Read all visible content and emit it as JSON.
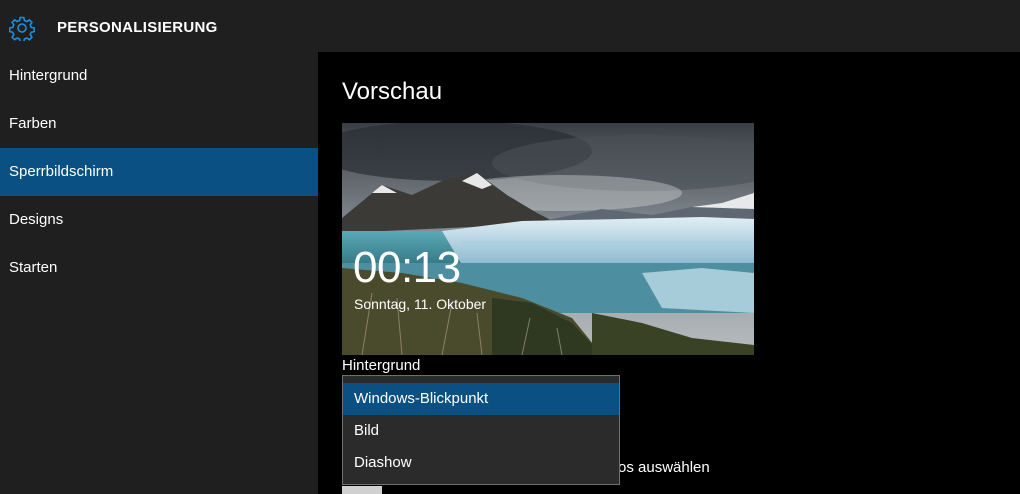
{
  "app": {
    "title": "PERSONALISIERUNG",
    "icon": "gear-icon",
    "accent_color": "#0a5083"
  },
  "sidebar": {
    "items": [
      {
        "label": "Hintergrund",
        "selected": false
      },
      {
        "label": "Farben",
        "selected": false
      },
      {
        "label": "Sperrbildschirm",
        "selected": true
      },
      {
        "label": "Designs",
        "selected": false
      },
      {
        "label": "Starten",
        "selected": false
      }
    ]
  },
  "main": {
    "section_title": "Vorschau",
    "preview": {
      "time": "00:13",
      "date": "Sonntag, 11. Oktober",
      "image": "glacier-landscape"
    },
    "background_label": "Hintergrund",
    "dropdown": {
      "options": [
        {
          "label": "Windows-Blickpunkt",
          "selected": true
        },
        {
          "label": "Bild",
          "selected": false
        },
        {
          "label": "Diashow",
          "selected": false
        }
      ]
    },
    "obscured_text": "os auswählen"
  }
}
